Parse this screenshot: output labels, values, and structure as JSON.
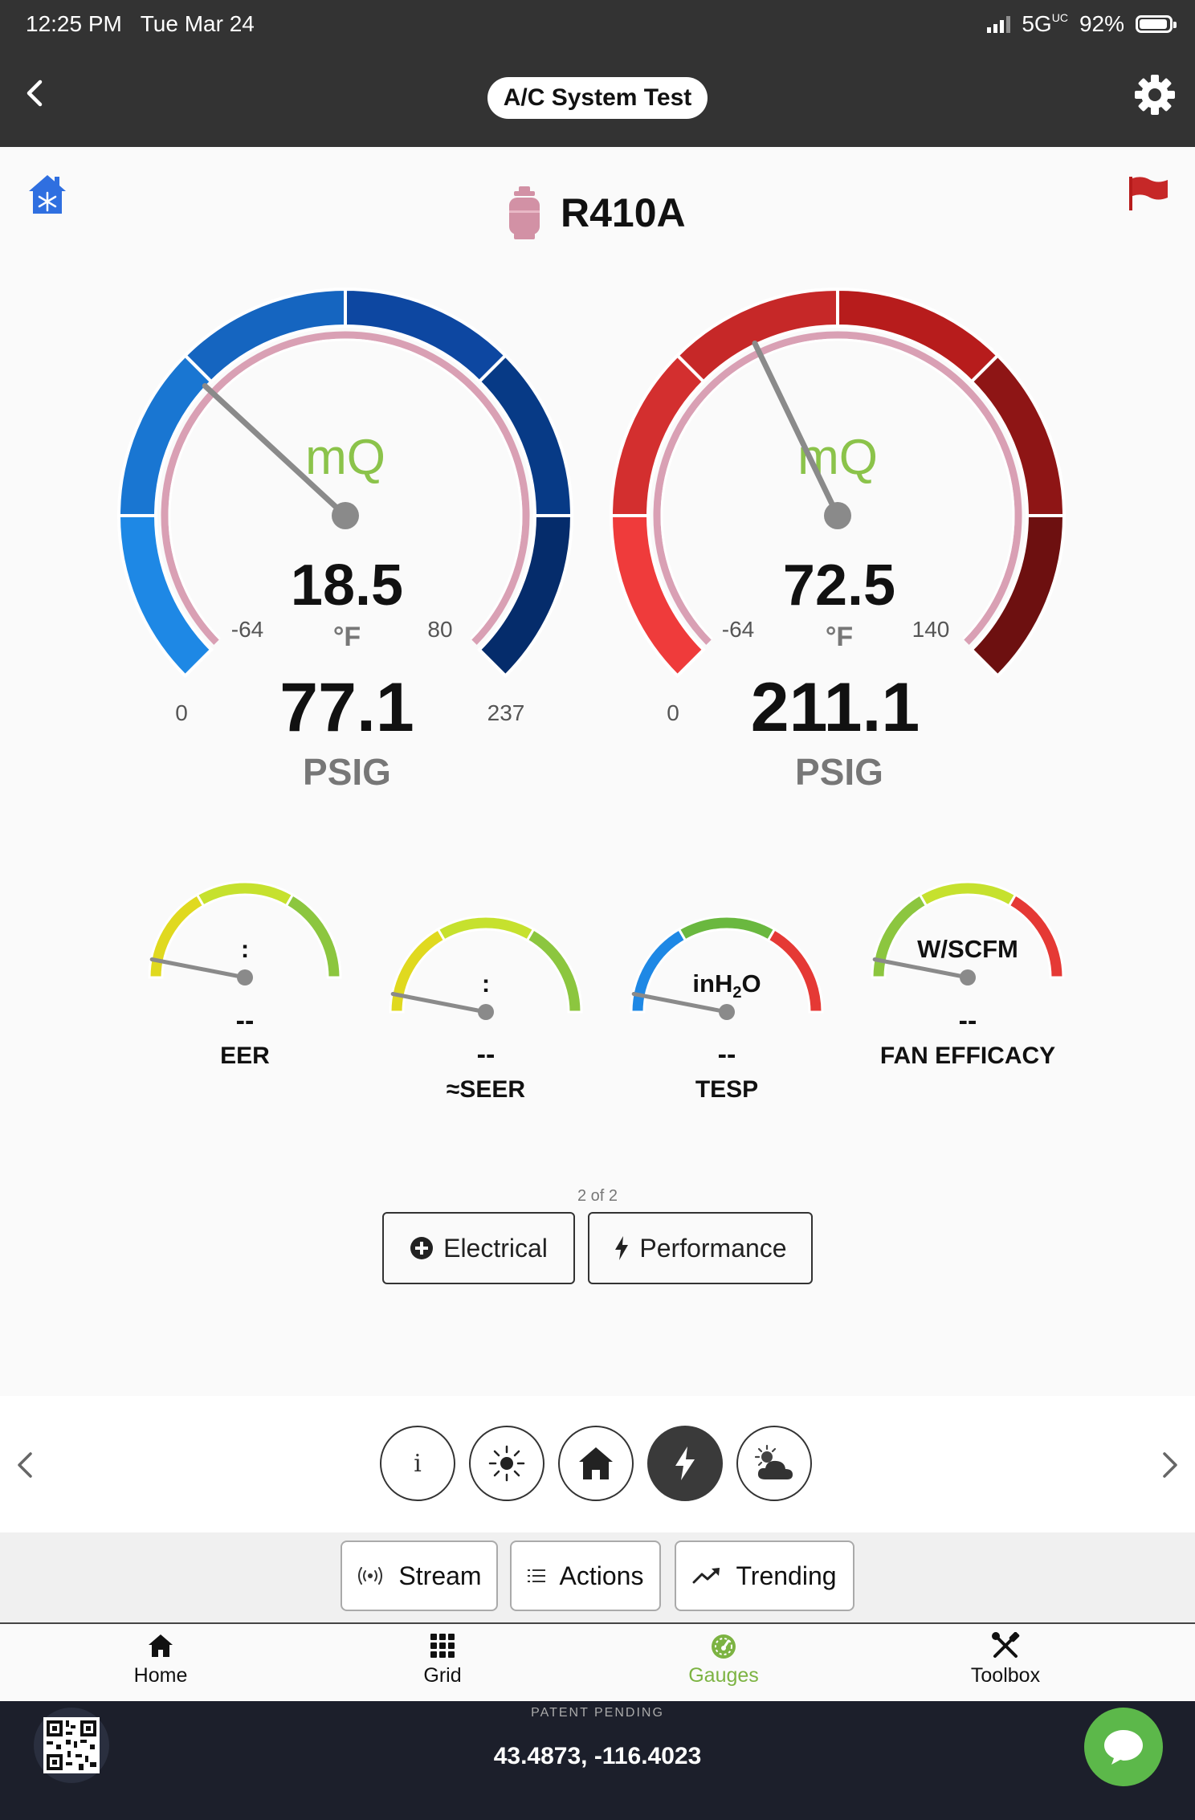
{
  "status_bar": {
    "time": "12:25 PM",
    "date": "Tue Mar 24",
    "network": "5G",
    "network_suffix": "UC",
    "battery": "92%"
  },
  "header": {
    "title": "A/C System Test"
  },
  "refrigerant": {
    "name": "R410A"
  },
  "gauges": {
    "low": {
      "brand": "mQ",
      "temp": "18.5",
      "temp_unit": "°F",
      "temp_min": "-64",
      "temp_max": "80",
      "pressure": "77.1",
      "pressure_unit": "PSIG",
      "pressure_min": "0",
      "pressure_max": "237",
      "needle_fraction": 0.325,
      "color": "#1565c0"
    },
    "high": {
      "brand": "mQ",
      "temp": "72.5",
      "temp_unit": "°F",
      "temp_min": "-64",
      "temp_max": "140",
      "pressure": "211.1",
      "pressure_unit": "PSIG",
      "pressure_min": "0",
      "pressure_max": "",
      "needle_fraction": 0.405,
      "color": "#c62828"
    }
  },
  "mini_gauges": [
    {
      "unit": ":",
      "value": "--",
      "label": "EER"
    },
    {
      "unit": ":",
      "value": "--",
      "label": "≈SEER"
    },
    {
      "unit_main": "inH",
      "unit_sub": "2",
      "unit_end": "O",
      "value": "--",
      "label": "TESP"
    },
    {
      "unit": "W/SCFM",
      "value": "--",
      "label": "FAN EFFICACY"
    }
  ],
  "pager": {
    "text": "2 of 2"
  },
  "buttons": {
    "electrical": "Electrical",
    "performance": "Performance"
  },
  "icon_strip": {
    "items": [
      "info-icon",
      "sun-icon",
      "home-icon",
      "bolt-icon",
      "cloud-sun-icon"
    ],
    "active": "bolt-icon",
    "info_glyph": "i"
  },
  "actions": {
    "stream": "Stream",
    "actions": "Actions",
    "trending": "Trending"
  },
  "tabs": [
    {
      "label": "Home",
      "icon": "home-icon"
    },
    {
      "label": "Grid",
      "icon": "grid-icon"
    },
    {
      "label": "Gauges",
      "icon": "gauge-icon",
      "active": true
    },
    {
      "label": "Toolbox",
      "icon": "toolbox-icon"
    }
  ],
  "footer": {
    "patent": "PATENT PENDING",
    "coordinates": "43.4873, -116.4023"
  },
  "colors": {
    "accent_green": "#7cb342",
    "header_bg": "#333333",
    "footer_bg": "#1c1f2b"
  }
}
